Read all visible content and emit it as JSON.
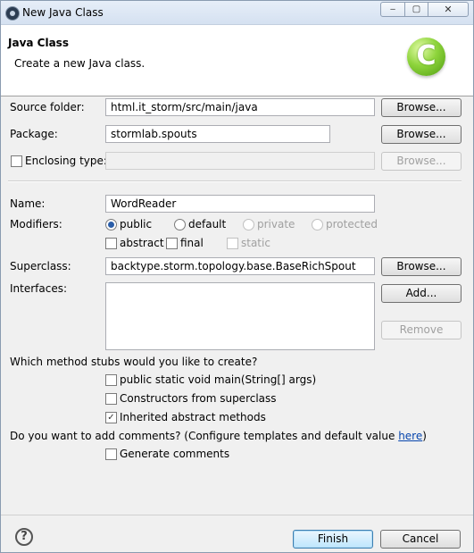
{
  "window": {
    "title": "New Java Class",
    "controls": {
      "minimize": "‒",
      "maximize": "▢",
      "close": "✕"
    }
  },
  "header": {
    "title": "Java Class",
    "subtitle": "Create a new Java class.",
    "logo_letter": "C"
  },
  "form": {
    "source_folder": {
      "label": "Source folder:",
      "value": "html.it_storm/src/main/java",
      "browse": "Browse..."
    },
    "package": {
      "label": "Package:",
      "value": "stormlab.spouts",
      "browse": "Browse..."
    },
    "enclosing_type": {
      "label": "Enclosing type:",
      "value": "",
      "checked": false,
      "browse": "Browse..."
    },
    "name": {
      "label": "Name:",
      "value": "WordReader"
    },
    "modifiers": {
      "label": "Modifiers:",
      "public": "public",
      "default": "default",
      "private": "private",
      "protected": "protected",
      "abstract": "abstract",
      "final": "final",
      "static": "static",
      "selected": "public"
    },
    "superclass": {
      "label": "Superclass:",
      "value": "backtype.storm.topology.base.BaseRichSpout",
      "browse": "Browse..."
    },
    "interfaces": {
      "label": "Interfaces:",
      "add": "Add...",
      "remove": "Remove"
    },
    "stubs": {
      "question": "Which method stubs would you like to create?",
      "main": {
        "label": "public static void main(String[] args)",
        "checked": false
      },
      "constructors": {
        "label": "Constructors from superclass",
        "checked": false
      },
      "inherited": {
        "label": "Inherited abstract methods",
        "checked": true
      }
    },
    "comments": {
      "question": "Do you want to add comments? (Configure templates and default value ",
      "link": "here",
      "close_paren": ")",
      "generate": {
        "label": "Generate comments",
        "checked": false
      }
    }
  },
  "footer": {
    "help_icon": "?",
    "finish": "Finish",
    "cancel": "Cancel"
  },
  "colors": {
    "logo_green": "#6cbf26",
    "link": "#0645ad",
    "radio_dot": "#2a5da8"
  }
}
